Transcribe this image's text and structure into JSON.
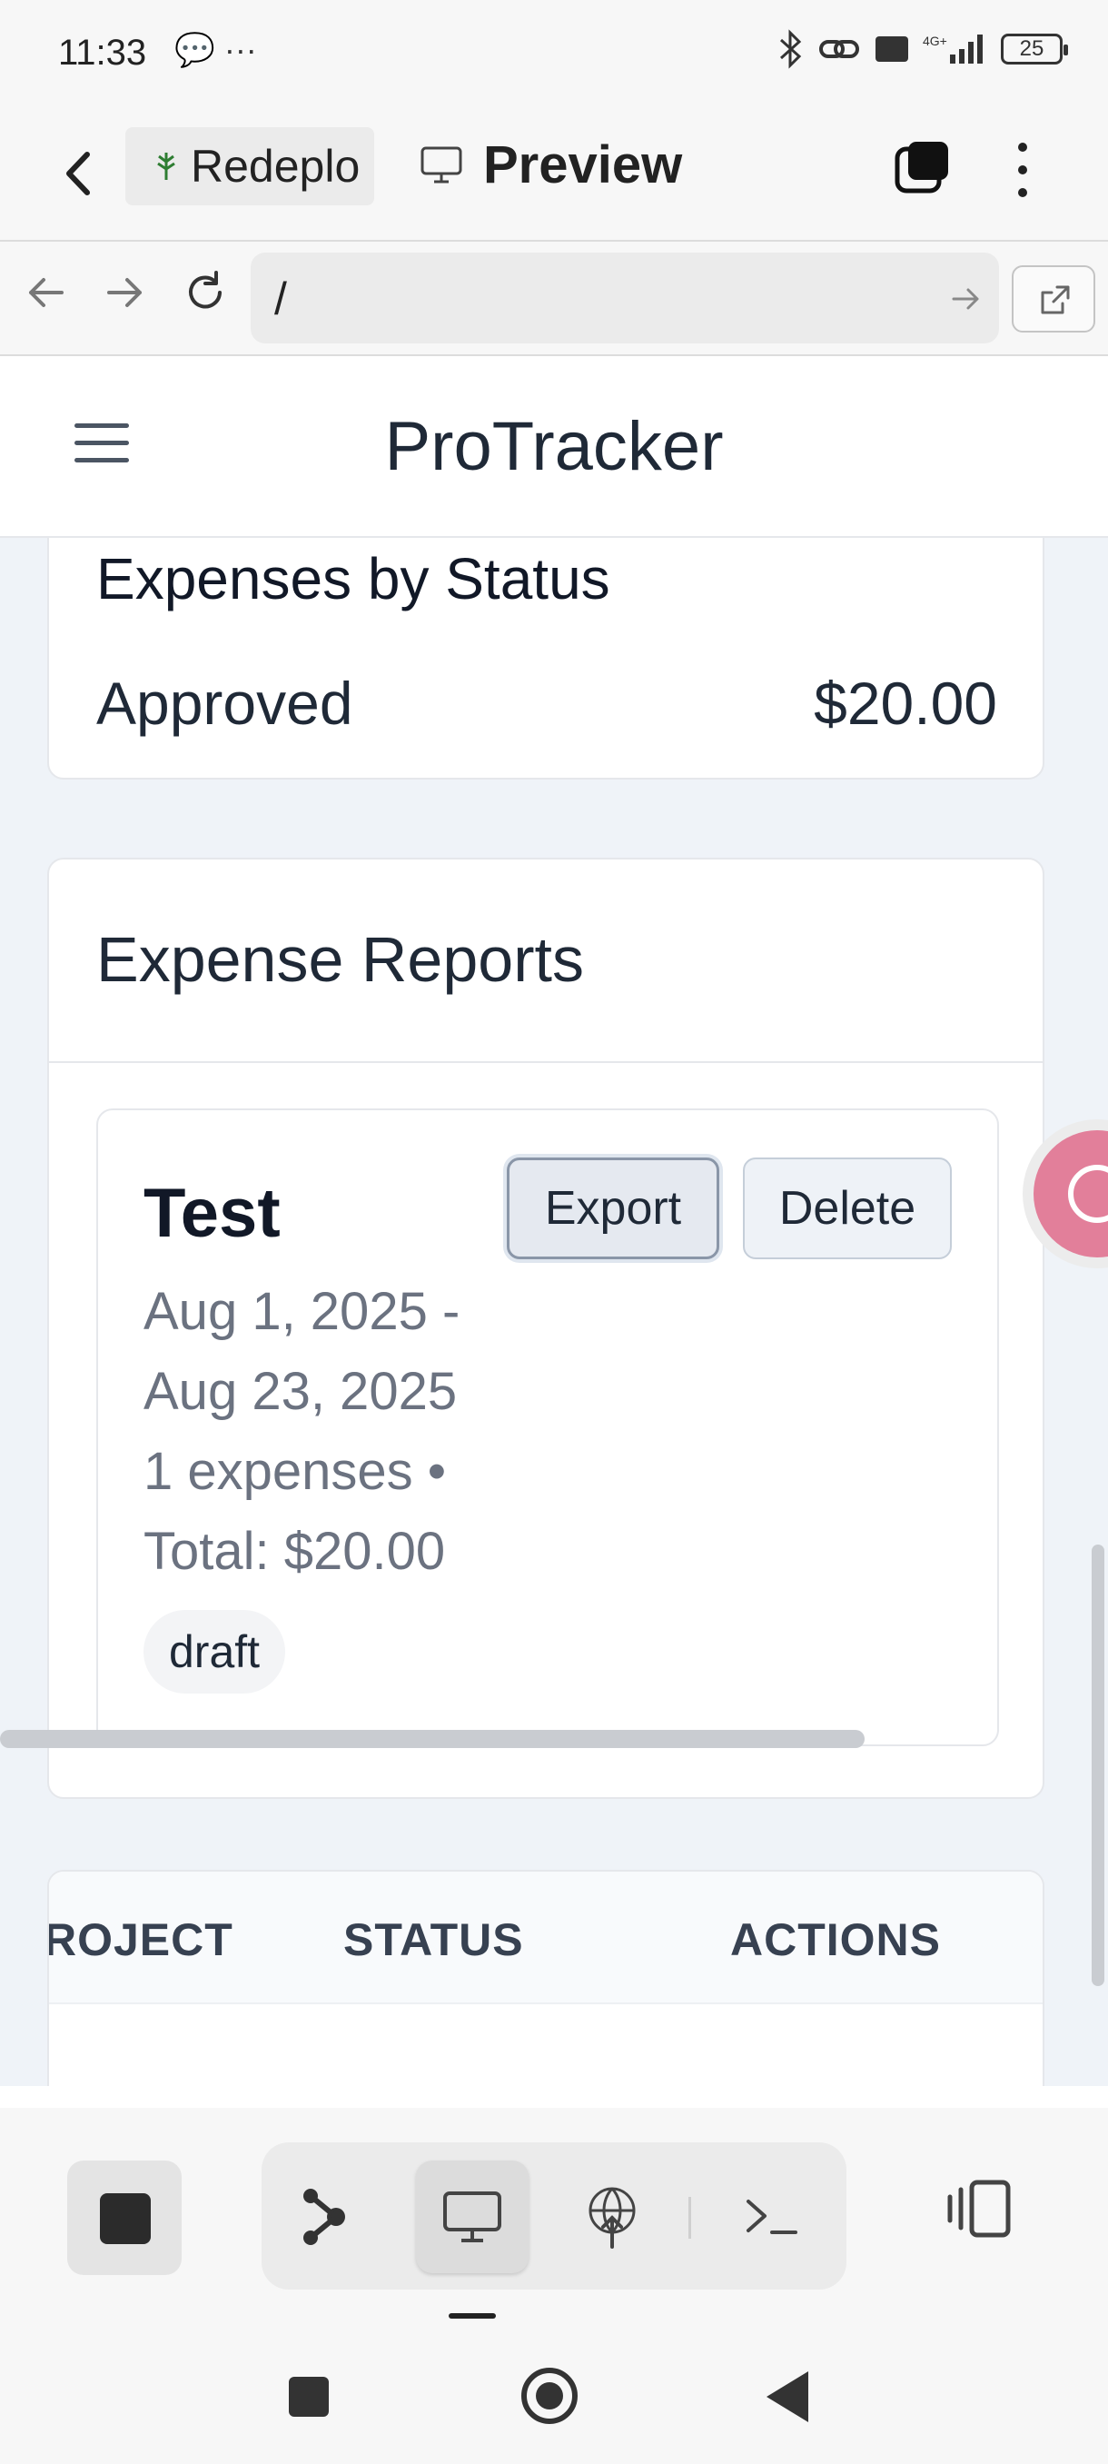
{
  "status_bar": {
    "time": "11:33",
    "left_icons": "💬 ···",
    "battery": "25"
  },
  "browser": {
    "chip_label": "Redeplo",
    "preview_label": "Preview",
    "url": "/"
  },
  "site": {
    "title": "ProTracker"
  },
  "expenses_by_status": {
    "title": "Expenses by Status",
    "status": "Approved",
    "amount": "$20.00"
  },
  "expense_reports": {
    "title": "Expense Reports",
    "report": {
      "name": "Test",
      "dates": "Aug 1, 2025 - Aug 23, 2025",
      "summary": "1 expenses • Total: $20.00",
      "badge": "draft",
      "export_label": "Export",
      "delete_label": "Delete"
    }
  },
  "table": {
    "headers": [
      "ROJECT",
      "STATUS",
      "ACTIONS"
    ]
  },
  "colors": {
    "content_bg": "#eff3f8",
    "fab": "#e27f9a"
  }
}
